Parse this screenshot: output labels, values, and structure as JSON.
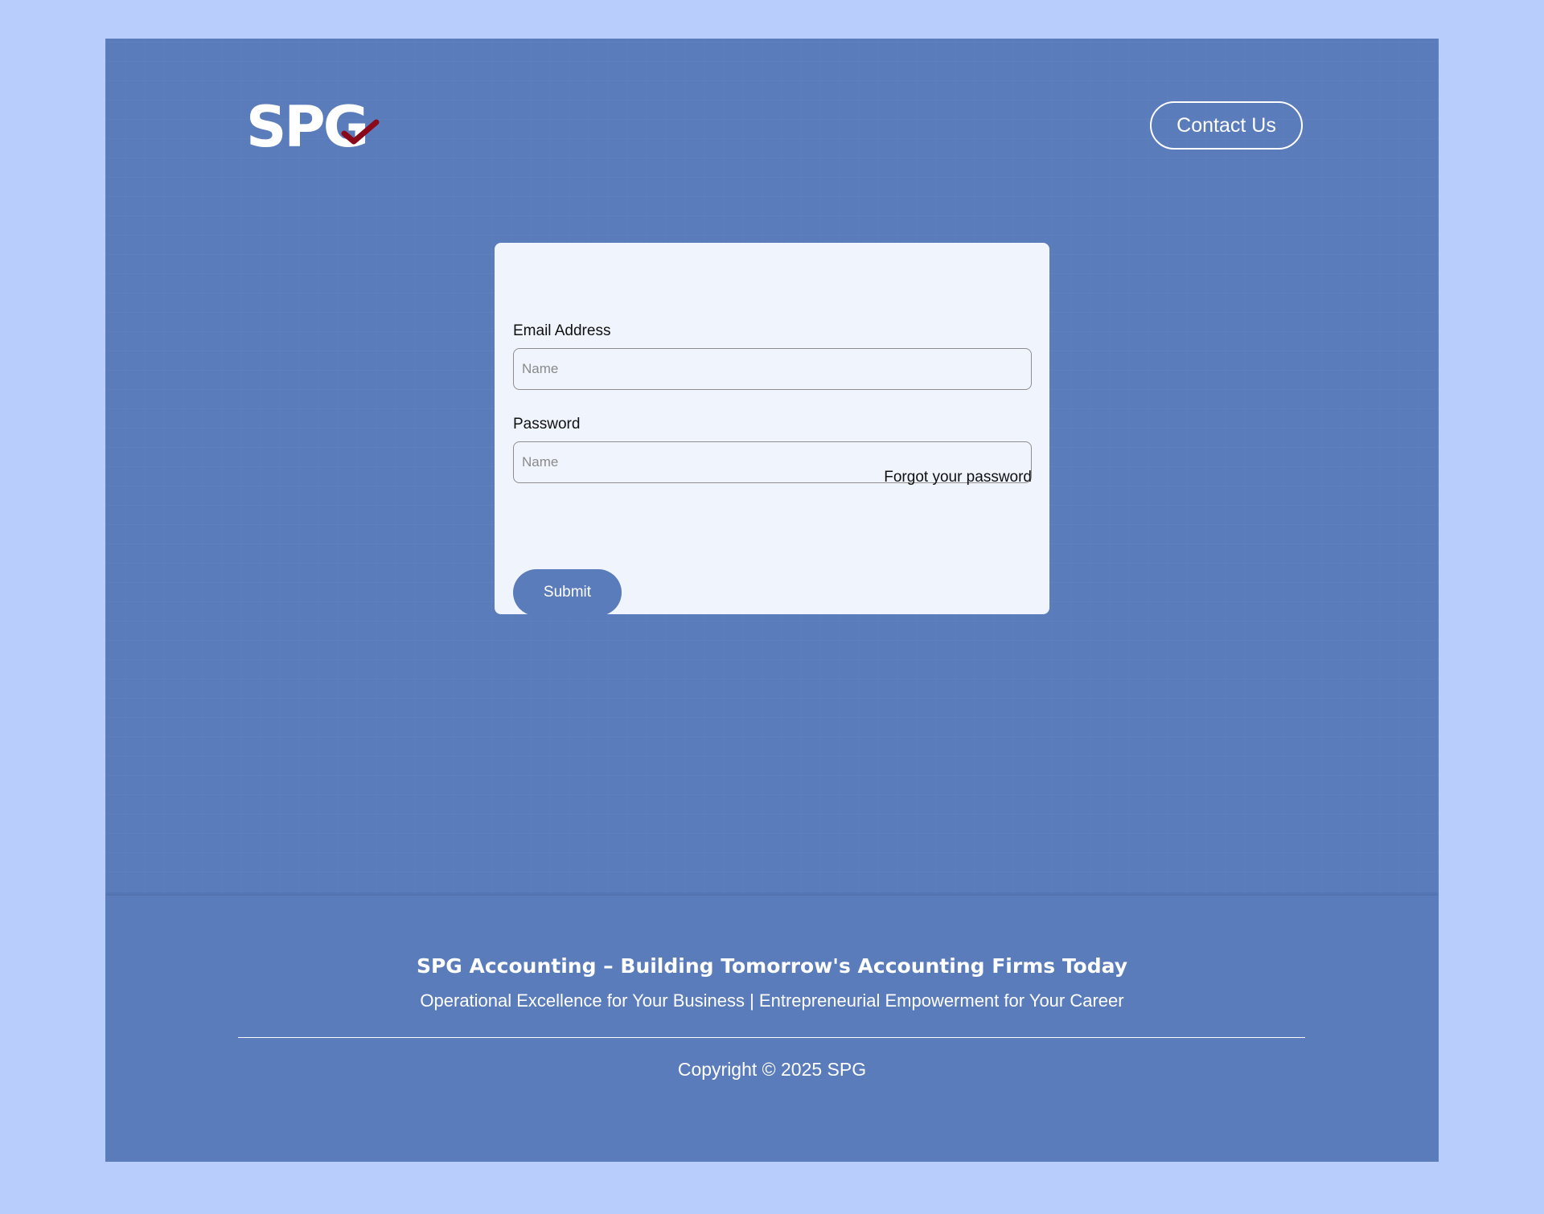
{
  "header": {
    "logo_text": "SPG",
    "contact_label": "Contact Us"
  },
  "login": {
    "email_label": "Email Address",
    "email_placeholder": "Name",
    "password_label": "Password",
    "password_placeholder": "Name",
    "forgot_label": "Forgot your password",
    "submit_label": "Submit"
  },
  "footer": {
    "tagline": "SPG Accounting – Building Tomorrow's Accounting Firms Today",
    "subline": "Operational Excellence for Your Business | Entrepreneurial Empowerment for Your Career",
    "copyright": "Copyright © 2025 SPG"
  },
  "colors": {
    "page_background": "#b8cdfc",
    "brand_blue": "#5a7cbb",
    "card_background": "#f0f4fd",
    "logo_check": "#8b0a1a"
  },
  "icons": {
    "logo_mark": "checkmark-icon"
  }
}
